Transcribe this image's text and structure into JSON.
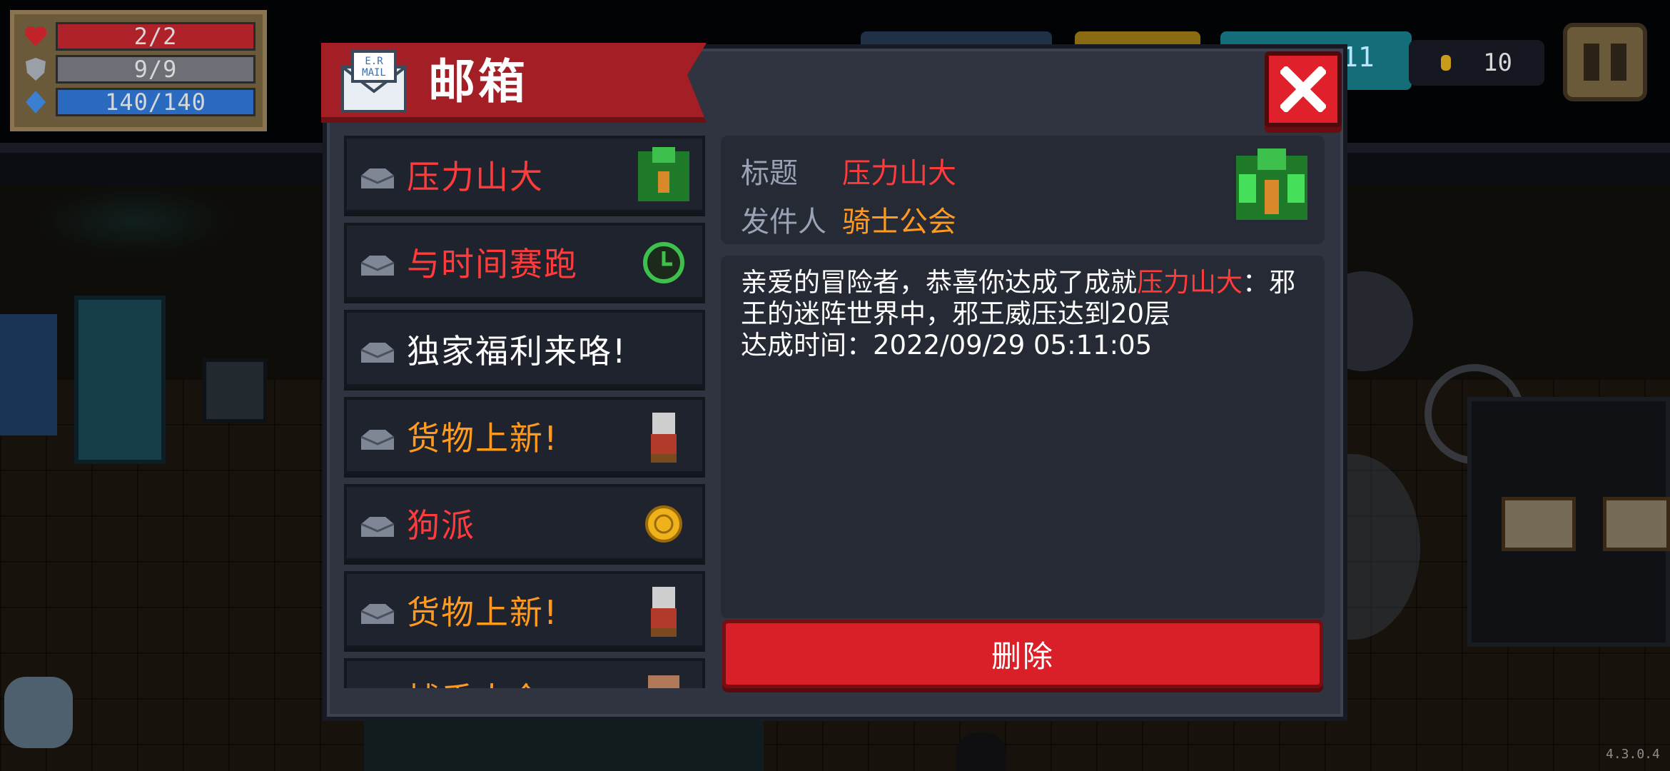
{
  "hud": {
    "hp": "2/2",
    "armor": "9/9",
    "energy": "140/140",
    "gems": "11",
    "coins": "10"
  },
  "mailbox": {
    "title": "邮箱",
    "mail_icon_text": "E.R MAIL",
    "items": [
      {
        "label": "压力山大",
        "color": "#ff3b3b",
        "thumb": "green-boss-icon"
      },
      {
        "label": "与时间赛跑",
        "color": "#ff3b3b",
        "thumb": "clock-icon"
      },
      {
        "label": "独家福利来咯!",
        "color": "#ffffff",
        "thumb": ""
      },
      {
        "label": "货物上新!",
        "color": "#ff9a1f",
        "thumb": "merchant-icon"
      },
      {
        "label": "狗派",
        "color": "#ff3b3b",
        "thumb": "gold-coin-icon"
      },
      {
        "label": "货物上新!",
        "color": "#ff9a1f",
        "thumb": "merchant-icon"
      },
      {
        "label": "捕手大全",
        "color": "#ff9a1f",
        "thumb": "character-icon"
      }
    ],
    "detail": {
      "title_key": "标题",
      "title_value": "压力山大",
      "sender_key": "发件人",
      "sender_value": "骑士公会",
      "body_prefix": "亲爱的冒险者，恭喜你达成了成就",
      "body_highlight": "压力山大",
      "body_suffix": "：邪王的迷阵世界中，邪王威压达到20层",
      "body_time": "达成时间：2022/09/29 05:11:05"
    },
    "delete_label": "删除"
  },
  "version": "4.3.0.4",
  "colors": {
    "red": "#ff3b3b",
    "orange": "#ff9a1f",
    "banner": "#a41e25"
  }
}
